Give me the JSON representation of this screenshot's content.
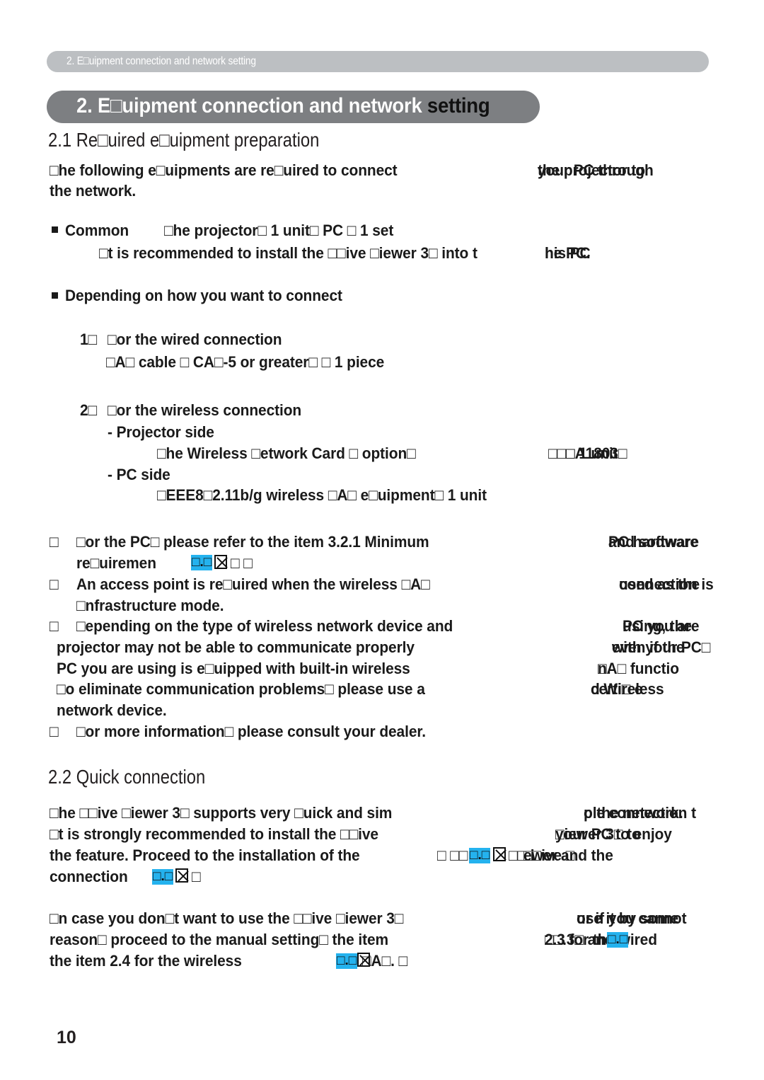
{
  "page": {
    "number": "10",
    "running_header": "2. E□uipment connection and network setting"
  },
  "chapter": {
    "title_main": "2. E□uipment connection and network",
    "title_shadow": "2. E□uipment connection and network setting"
  },
  "sections": {
    "s21_heading": "2.1 Re□uired e□uipment preparation",
    "s22_heading": "2.2 Quick connection"
  },
  "colors": {
    "running_header_bg": "#bcbfc2",
    "chapter_pill_bg": "#7d7f82",
    "link_highlight": "#24b2ee",
    "text": "#1a1a1a",
    "heading": "#231f20",
    "tofu_border": "#8d8d8d"
  },
  "intro": {
    "line1": "□he following e□uipments are re□uired to connect",
    "line1_overlap_a": "the projector to",
    "line1_overlap_b": "your PC through",
    "line2": "the network."
  },
  "common": {
    "bullet_label": "Common",
    "items": "□he projector□ 1 unit□    PC □ 1 set",
    "note_line": "□t is recommended to install the □□ive □iewer 3□ into t",
    "note_overlap_a": "his PC",
    "note_overlap_b": "he PC."
  },
  "depending": {
    "bullet_label": "Depending on how you want to connect",
    "item1_num": "1□",
    "item1_label": "□or the wired connection",
    "item1_detail": "□A□ cable □ CA□-5 or greater□ □ 1 piece",
    "item2_num": "2□",
    "item2_label": "□or the wireless connection",
    "item2_sub1": "- Projector side",
    "item2_sub1_detail": "□he Wireless □etwork Card □ option□",
    "item2_sub1_overlap_a": "□□□A1803□",
    "item2_sub1_overlap_b": "□ 1 unit",
    "item2_sub2": "- PC side",
    "item2_sub2_detail": "□EEE8□2.11b/g wireless □A□ e□uipment□ 1 unit"
  },
  "notes": [
    {
      "marker": "□",
      "line1": "□or the PC□ please refer to the item 3.2.1 Minimum",
      "line1_overlap_a": "PC hardware",
      "line1_overlap_b": "and software",
      "line2_pre": "re□uiremen",
      "line2_post": "t",
      "link_text": "□",
      "link_text2": "□",
      "line2_tail": "□ □",
      "line2_num": "□.□"
    },
    {
      "marker": "□",
      "line1": "An access point is re□uired when the wireless □A□",
      "line1_overlap_a": "connection is",
      "line1_overlap_b": "used as the",
      "line2": "□nfrastructure mode."
    },
    {
      "marker": "□",
      "line1": "□epending on the type of wireless network device and",
      "line1_overlap_a": "PC you are",
      "line1_overlap_b": "using, the",
      "line2": "projector may not be able to communicate properly",
      "line2_overlap_a": "with your PC□",
      "line2_overlap_b": "even if the",
      "line3": "PC you are using is e□uipped with built-in wireless",
      "line3_overlap_a": "□A□ functio",
      "line3_overlap_b": "n.",
      "line4": "□o eliminate communication problems□ please use a",
      "line4_overlap_a": "certi□ e",
      "line4_overlap_b": "d Wireless",
      "line5": "network device."
    },
    {
      "marker": "□",
      "line1": "□or more information□ please consult your dealer."
    }
  ],
  "quick": {
    "p1_line1": "□he □□ive □iewer 3□ supports very □uick and sim",
    "p1_line1_overlap_a": "ple connection t",
    "p1_line1_overlap_b": "o the network.",
    "p1_line2": "□t is strongly recommended to install the □□ive",
    "p1_line2_overlap_a": "□iewer 3□ to",
    "p1_line2_overlap_b": "your PC to enjoy",
    "p1_line3_pre": "the feature. Proceed to the installation of the",
    "p1_line3_mid": "□ □□",
    "p1_line3_link": "□.□",
    "p1_line3_post": "□□ i",
    "p1_line3_overlap_a": "ewer and the",
    "p1_line3_overlap_b": "□□ive □",
    "p1_line4_pre": "connection",
    "p1_line4_link": "□.□",
    "p1_line4_post": "□",
    "p2_line1": "□n case you don□t want to use the □□ive □iewer 3□",
    "p2_line1_overlap_a": "or if you cannot",
    "p2_line1_overlap_b": "use it by some",
    "p2_line2": "reason□ proceed to the manual setting□ the item",
    "p2_line2_overlap_a": "2.3 for the wired",
    "p2_line2_overlap_b": "□□.3□ and",
    "p2_line2_link": "□.□",
    "p3_line_pre": "the item 2.4 for the wireless",
    "p3_line_link": "□.□",
    "p3_line_post": "□A□. □"
  }
}
